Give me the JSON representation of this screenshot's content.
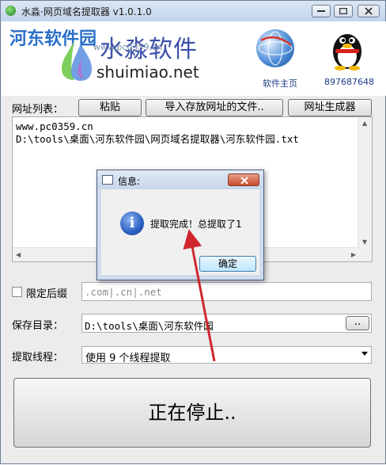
{
  "window": {
    "title": "水淼·网页域名提取器 v1.0.1.0"
  },
  "banner": {
    "site_watermark": "河东软件园",
    "site_url": "www.pc0359.cn",
    "brand_name": "水淼软件",
    "brand_domain": "shuimiao.net",
    "home_label": "软件主页",
    "qq_number": "897687648"
  },
  "url_list": {
    "label": "网址列表：",
    "paste_button": "粘贴",
    "import_button": "导入存放网址的文件..",
    "generator_button": "网址生成器",
    "lines": "www.pc0359.cn\nD:\\tools\\桌面\\河东软件园\\网页域名提取器\\河东软件园.txt"
  },
  "suffix": {
    "label": "限定后缀",
    "checked": false,
    "placeholder": ".com|.cn|.net"
  },
  "save_dir": {
    "label": "保存目录：",
    "value": "D:\\tools\\桌面\\河东软件园",
    "browse_button": ".."
  },
  "threads": {
    "label": "提取线程：",
    "selected": "使用 9 个线程提取"
  },
  "main_button": "正在停止..",
  "dialog": {
    "title": "信息:",
    "message": "提取完成！总提取了1",
    "ok_button": "确定"
  },
  "colors": {
    "accent_blue": "#2a5fc2",
    "annotation_red": "#d0262d"
  }
}
